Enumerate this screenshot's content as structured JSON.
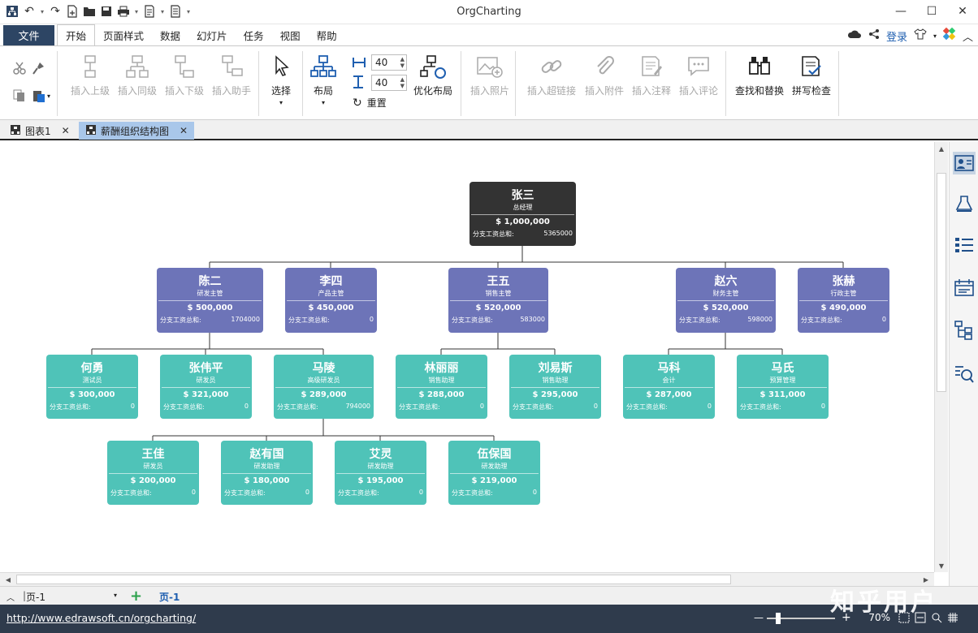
{
  "app": {
    "title": "OrgCharting"
  },
  "menu": {
    "file": "文件",
    "tabs": [
      "开始",
      "页面样式",
      "数据",
      "幻灯片",
      "任务",
      "视图",
      "帮助"
    ],
    "login": "登录"
  },
  "ribbon": {
    "insert_parent": "插入上级",
    "insert_sibling": "插入同级",
    "insert_child": "插入下级",
    "insert_assistant": "插入助手",
    "select": "选择",
    "layout": "布局",
    "spacing_h": "40",
    "spacing_v": "40",
    "reset": "重置",
    "optimize_layout": "优化布局",
    "insert_photo": "插入照片",
    "insert_hyperlink": "插入超链接",
    "insert_attachment": "插入附件",
    "insert_note": "插入注释",
    "insert_comment": "插入评论",
    "find_replace": "查找和替换",
    "spell_check": "拼写检查"
  },
  "doc_tabs": [
    "图表1",
    "薪酬组织结构图"
  ],
  "org": {
    "subtotal_label": "分支工资总和:",
    "nodes": [
      {
        "name": "张三",
        "title": "总经理",
        "salary": "$ 1,000,000",
        "subtotal": "5365000"
      },
      {
        "name": "陈二",
        "title": "研发主管",
        "salary": "$ 500,000",
        "subtotal": "1704000"
      },
      {
        "name": "李四",
        "title": "产品主管",
        "salary": "$ 450,000",
        "subtotal": "0"
      },
      {
        "name": "王五",
        "title": "销售主管",
        "salary": "$ 520,000",
        "subtotal": "583000"
      },
      {
        "name": "赵六",
        "title": "财务主管",
        "salary": "$ 520,000",
        "subtotal": "598000"
      },
      {
        "name": "张赫",
        "title": "行政主管",
        "salary": "$ 490,000",
        "subtotal": "0"
      },
      {
        "name": "何勇",
        "title": "测试员",
        "salary": "$ 300,000",
        "subtotal": "0"
      },
      {
        "name": "张伟平",
        "title": "研发员",
        "salary": "$ 321,000",
        "subtotal": "0"
      },
      {
        "name": "马陵",
        "title": "高级研发员",
        "salary": "$ 289,000",
        "subtotal": "794000"
      },
      {
        "name": "林丽丽",
        "title": "销售助理",
        "salary": "$ 288,000",
        "subtotal": "0"
      },
      {
        "name": "刘易斯",
        "title": "销售助理",
        "salary": "$ 295,000",
        "subtotal": "0"
      },
      {
        "name": "马科",
        "title": "会计",
        "salary": "$ 287,000",
        "subtotal": "0"
      },
      {
        "name": "马氏",
        "title": "预算管理",
        "salary": "$ 311,000",
        "subtotal": "0"
      },
      {
        "name": "王佳",
        "title": "研发员",
        "salary": "$ 200,000",
        "subtotal": "0"
      },
      {
        "name": "赵有国",
        "title": "研发助理",
        "salary": "$ 180,000",
        "subtotal": "0"
      },
      {
        "name": "艾灵",
        "title": "研发助理",
        "salary": "$ 195,000",
        "subtotal": "0"
      },
      {
        "name": "伍保国",
        "title": "研发助理",
        "salary": "$ 219,000",
        "subtotal": "0"
      }
    ]
  },
  "pagebar": {
    "page_selector": "页-1",
    "active_page": "页-1"
  },
  "status": {
    "url": "http://www.edrawsoft.cn/orgcharting/",
    "zoom": "70%",
    "watermark": "知乎用户"
  },
  "colors": {
    "root": "#333333",
    "manager": "#6d74b8",
    "staff": "#4fc3b8",
    "file_tab": "#2d4564",
    "status_bar": "#2f3b4c"
  }
}
